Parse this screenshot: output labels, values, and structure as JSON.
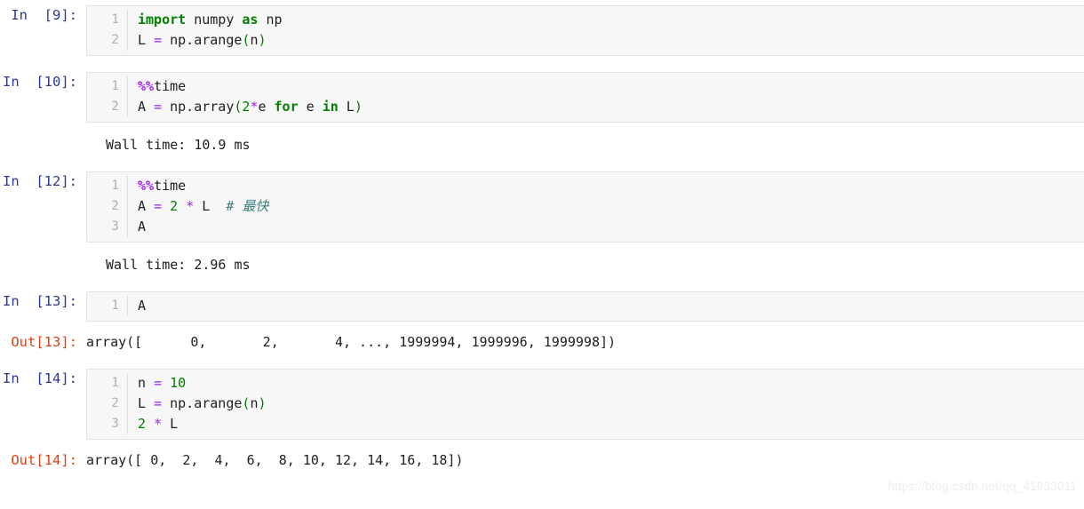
{
  "notebook": {
    "watermark": "https://blog.csdn.net/qq_41033011",
    "cells": [
      {
        "prompt": "In  [9]:",
        "lines": [
          "1",
          "2"
        ],
        "code": [
          [
            {
              "t": "import",
              "c": "kw"
            },
            {
              "t": " numpy ",
              "c": "plain"
            },
            {
              "t": "as",
              "c": "kw"
            },
            {
              "t": " np",
              "c": "plain"
            }
          ],
          [
            {
              "t": "L ",
              "c": "plain"
            },
            {
              "t": "=",
              "c": "op"
            },
            {
              "t": " np.arange",
              "c": "plain"
            },
            {
              "t": "(",
              "c": "paren"
            },
            {
              "t": "n",
              "c": "plain"
            },
            {
              "t": ")",
              "c": "paren"
            }
          ]
        ]
      },
      {
        "prompt": "In  [10]:",
        "lines": [
          "1",
          "2"
        ],
        "code": [
          [
            {
              "t": "%%",
              "c": "magic"
            },
            {
              "t": "time",
              "c": "magic-n"
            }
          ],
          [
            {
              "t": "A ",
              "c": "plain"
            },
            {
              "t": "=",
              "c": "op"
            },
            {
              "t": " np.array",
              "c": "plain"
            },
            {
              "t": "(",
              "c": "paren"
            },
            {
              "t": "2",
              "c": "num"
            },
            {
              "t": "*",
              "c": "op"
            },
            {
              "t": "e ",
              "c": "plain"
            },
            {
              "t": "for",
              "c": "kw"
            },
            {
              "t": " e ",
              "c": "plain"
            },
            {
              "t": "in",
              "c": "kw"
            },
            {
              "t": " L",
              "c": "plain"
            },
            {
              "t": ")",
              "c": "paren"
            }
          ]
        ],
        "stream": "Wall time: 10.9 ms"
      },
      {
        "prompt": "In  [12]:",
        "lines": [
          "1",
          "2",
          "3"
        ],
        "code": [
          [
            {
              "t": "%%",
              "c": "magic"
            },
            {
              "t": "time",
              "c": "magic-n"
            }
          ],
          [
            {
              "t": "A ",
              "c": "plain"
            },
            {
              "t": "=",
              "c": "op"
            },
            {
              "t": " ",
              "c": "plain"
            },
            {
              "t": "2",
              "c": "num"
            },
            {
              "t": " ",
              "c": "plain"
            },
            {
              "t": "*",
              "c": "op"
            },
            {
              "t": " L  ",
              "c": "plain"
            },
            {
              "t": "# 最快",
              "c": "comment"
            }
          ],
          [
            {
              "t": "A",
              "c": "plain"
            }
          ]
        ],
        "stream": "Wall time: 2.96 ms"
      },
      {
        "prompt": "In  [13]:",
        "lines": [
          "1"
        ],
        "code": [
          [
            {
              "t": "A",
              "c": "plain"
            }
          ]
        ],
        "out_prompt": "Out[13]:",
        "out_text": "array([      0,       2,       4, ..., 1999994, 1999996, 1999998])"
      },
      {
        "prompt": "In  [14]:",
        "lines": [
          "1",
          "2",
          "3"
        ],
        "code": [
          [
            {
              "t": "n ",
              "c": "plain"
            },
            {
              "t": "=",
              "c": "op"
            },
            {
              "t": " ",
              "c": "plain"
            },
            {
              "t": "10",
              "c": "num"
            }
          ],
          [
            {
              "t": "L ",
              "c": "plain"
            },
            {
              "t": "=",
              "c": "op"
            },
            {
              "t": " np.arange",
              "c": "plain"
            },
            {
              "t": "(",
              "c": "paren"
            },
            {
              "t": "n",
              "c": "plain"
            },
            {
              "t": ")",
              "c": "paren"
            }
          ],
          [
            {
              "t": "2",
              "c": "num"
            },
            {
              "t": " ",
              "c": "plain"
            },
            {
              "t": "*",
              "c": "op"
            },
            {
              "t": " L",
              "c": "plain"
            }
          ]
        ],
        "out_prompt": "Out[14]:",
        "out_text": "array([ 0,  2,  4,  6,  8, 10, 12, 14, 16, 18])"
      }
    ]
  }
}
